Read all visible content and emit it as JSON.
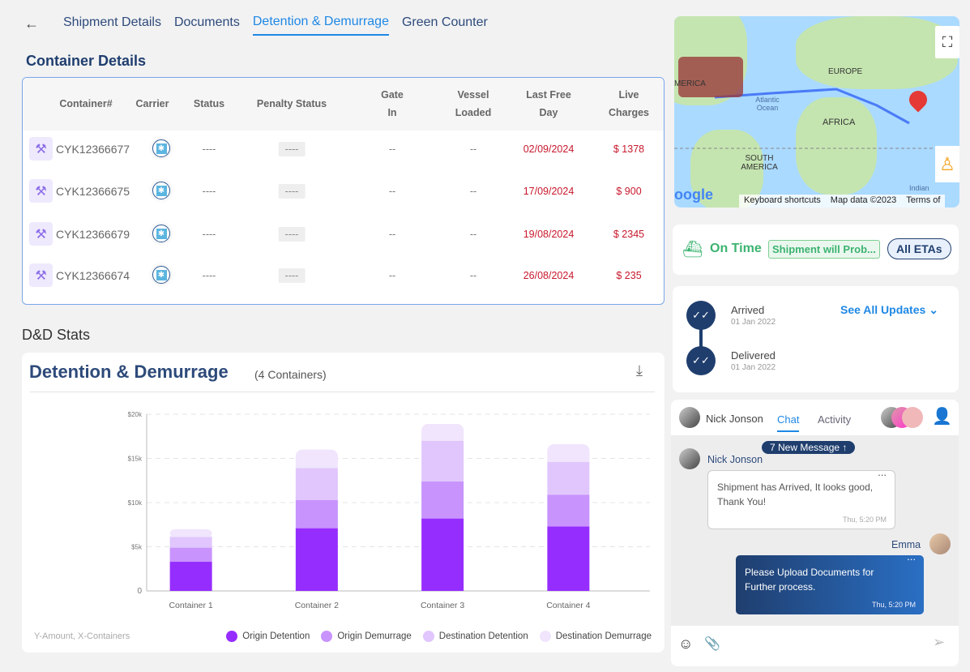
{
  "nav": {
    "tabs": [
      "Shipment Details",
      "Documents",
      "Detention & Demurrage",
      "Green Counter"
    ],
    "active": 2
  },
  "container_details": {
    "title": "Container Details",
    "columns": [
      "Container#",
      "Carrier",
      "Status",
      "Penalty Status",
      "Gate In",
      "Vessel Loaded",
      "Last Free Day",
      "Live Charges"
    ],
    "rows": [
      {
        "id": "CYK12366677",
        "status": "----",
        "penalty": "----",
        "gate_in": "--",
        "vessel_loaded": "--",
        "last_free_day": "02/09/2024",
        "charges": "$ 1378"
      },
      {
        "id": "CYK12366675",
        "status": "----",
        "penalty": "----",
        "gate_in": "--",
        "vessel_loaded": "--",
        "last_free_day": "17/09/2024",
        "charges": "$ 900"
      },
      {
        "id": "CYK12366679",
        "status": "----",
        "penalty": "----",
        "gate_in": "--",
        "vessel_loaded": "--",
        "last_free_day": "19/08/2024",
        "charges": "$ 2345"
      },
      {
        "id": "CYK12366674",
        "status": "----",
        "penalty": "----",
        "gate_in": "--",
        "vessel_loaded": "--",
        "last_free_day": "26/08/2024",
        "charges": "$ 235"
      }
    ]
  },
  "stats_title": "D&D Stats",
  "chart_data": {
    "type": "bar",
    "stacked": true,
    "title": "Detention & Demurrage",
    "subtitle": "(4 Containers)",
    "categories": [
      "Container 1",
      "Container 2",
      "Container 3",
      "Container 4"
    ],
    "ylim": [
      0,
      20000
    ],
    "yticks": [
      "0",
      "$5k",
      "$10k",
      "$15k",
      "$20k"
    ],
    "grid": true,
    "series": [
      {
        "name": "Origin Detention",
        "color": "#962dff",
        "values": [
          3300,
          7100,
          8200,
          7300
        ]
      },
      {
        "name": "Origin Demurrage",
        "color": "#c893fd",
        "values": [
          1600,
          3200,
          4200,
          3600
        ]
      },
      {
        "name": "Destination Detention",
        "color": "#e0c6fd",
        "values": [
          1200,
          3600,
          4600,
          3700
        ]
      },
      {
        "name": "Destination Demurrage",
        "color": "#f0e5fc",
        "values": [
          900,
          2100,
          1900,
          2000
        ]
      }
    ],
    "axis_note": "Y-Amount, X-Containers",
    "legend": "bottom-right"
  },
  "map": {
    "labels": [
      "MERICA",
      "EUROPE",
      "AFRICA",
      "SOUTH AMERICA",
      "Atlantic Ocean",
      "Indian"
    ],
    "google": "oogle",
    "footer": [
      "Keyboard shortcuts",
      "Map data ©2023",
      "Terms of"
    ]
  },
  "eta": {
    "status": "On Time",
    "note": "Shipment will Prob...",
    "button": "All ETAs",
    "color": "#3cb371"
  },
  "updates": {
    "items": [
      {
        "label": "Arrived",
        "date": "01 Jan 2022"
      },
      {
        "label": "Delivered",
        "date": "01 Jan 2022"
      }
    ],
    "link": "See All Updates"
  },
  "chat": {
    "user": "Nick Jonson",
    "tabs": [
      "Chat",
      "Activity"
    ],
    "new_msg": "7 New Message ↑",
    "messages": [
      {
        "sender": "Nick Jonson",
        "text": "Shipment has Arrived, It looks good, Thank You!",
        "time": "Thu, 5:20 PM"
      },
      {
        "sender": "Emma",
        "text": "Please Upload Documents for Further process.",
        "time": "Thu, 5:20 PM"
      }
    ],
    "more": "..."
  }
}
